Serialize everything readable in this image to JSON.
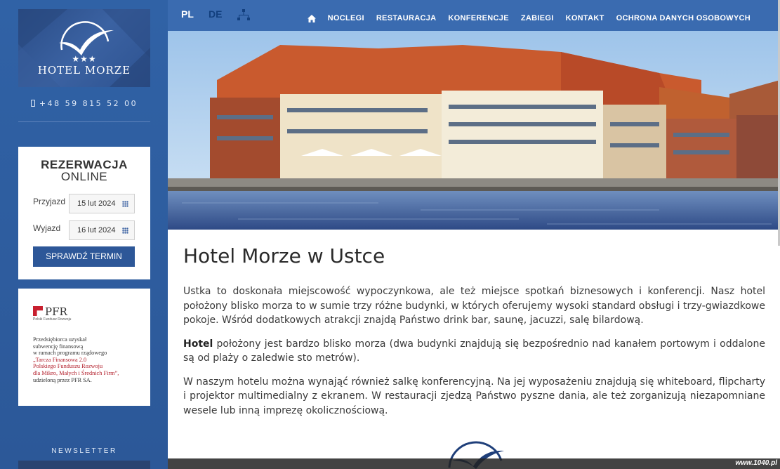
{
  "brand": {
    "logo_text": "HOTEL MORZE",
    "stars": "★★★",
    "phone": "+48 59 815 52 00"
  },
  "languages": [
    "PL",
    "DE"
  ],
  "nav": {
    "items": [
      "NOCLEGI",
      "RESTAURACJA",
      "KONFERENCJE",
      "ZABIEGI",
      "KONTAKT",
      "OCHRONA DANYCH OSOBOWYCH"
    ]
  },
  "booking": {
    "title": "REZERWACJA",
    "subtitle": "ONLINE",
    "arrival_label": "Przyjazd",
    "arrival_value": "15 lut 2024",
    "departure_label": "Wyjazd",
    "departure_value": "16 lut 2024",
    "button": "SPRAWDŹ TERMIN"
  },
  "pfr": {
    "name": "PFR",
    "subname": "Polski Fundusz Rozwoju",
    "line1": "Przedsiębiorca uzyskał",
    "line2": "subwencję finansową",
    "line3": "w ramach programu rządowego",
    "line4": "„Tarcza Finansowa 2.0",
    "line5": "Polskiego Funduszu Rozwoju",
    "line6": "dla Mikro, Małych i Średnich Firm”,",
    "line7": "udzieloną przez PFR SA."
  },
  "newsletter": "NEWSLETTER",
  "content": {
    "title": "Hotel Morze w Ustce",
    "p1": "Ustka to doskonała miejscowość wypoczynkowa, ale też miejsce spotkań biznesowych i konferencji. Nasz hotel położony blisko morza to w sumie trzy różne budynki, w których oferujemy wysoki standard obsługi i trzy-gwiazdkowe pokoje. Wśród dodatkowych atrakcji znajdą Państwo drink bar, saunę, jacuzzi, salę bilardową.",
    "p2_bold": "Hotel",
    "p2": " położony jest bardzo blisko morza (dwa budynki znajdują się bezpośrednio nad kanałem portowym i oddalone są od plaży o zaledwie sto metrów).",
    "p3": "W naszym hotelu można wynająć również salkę konferencyjną. Na jej wyposażeniu znajdują się whiteboard, flipcharty i projektor multimedialny z ekranem. W restauracji zjedzą Państwo pyszne dania, ale też zorganizują niezapomniane wesele lub inną imprezę okolicznościową."
  },
  "watermark": "www.1040.pl",
  "colors": {
    "sidebar": "#2f5ca0",
    "topbar": "#3a6bb0",
    "button": "#2d5798",
    "accent_red": "#c8202f"
  }
}
